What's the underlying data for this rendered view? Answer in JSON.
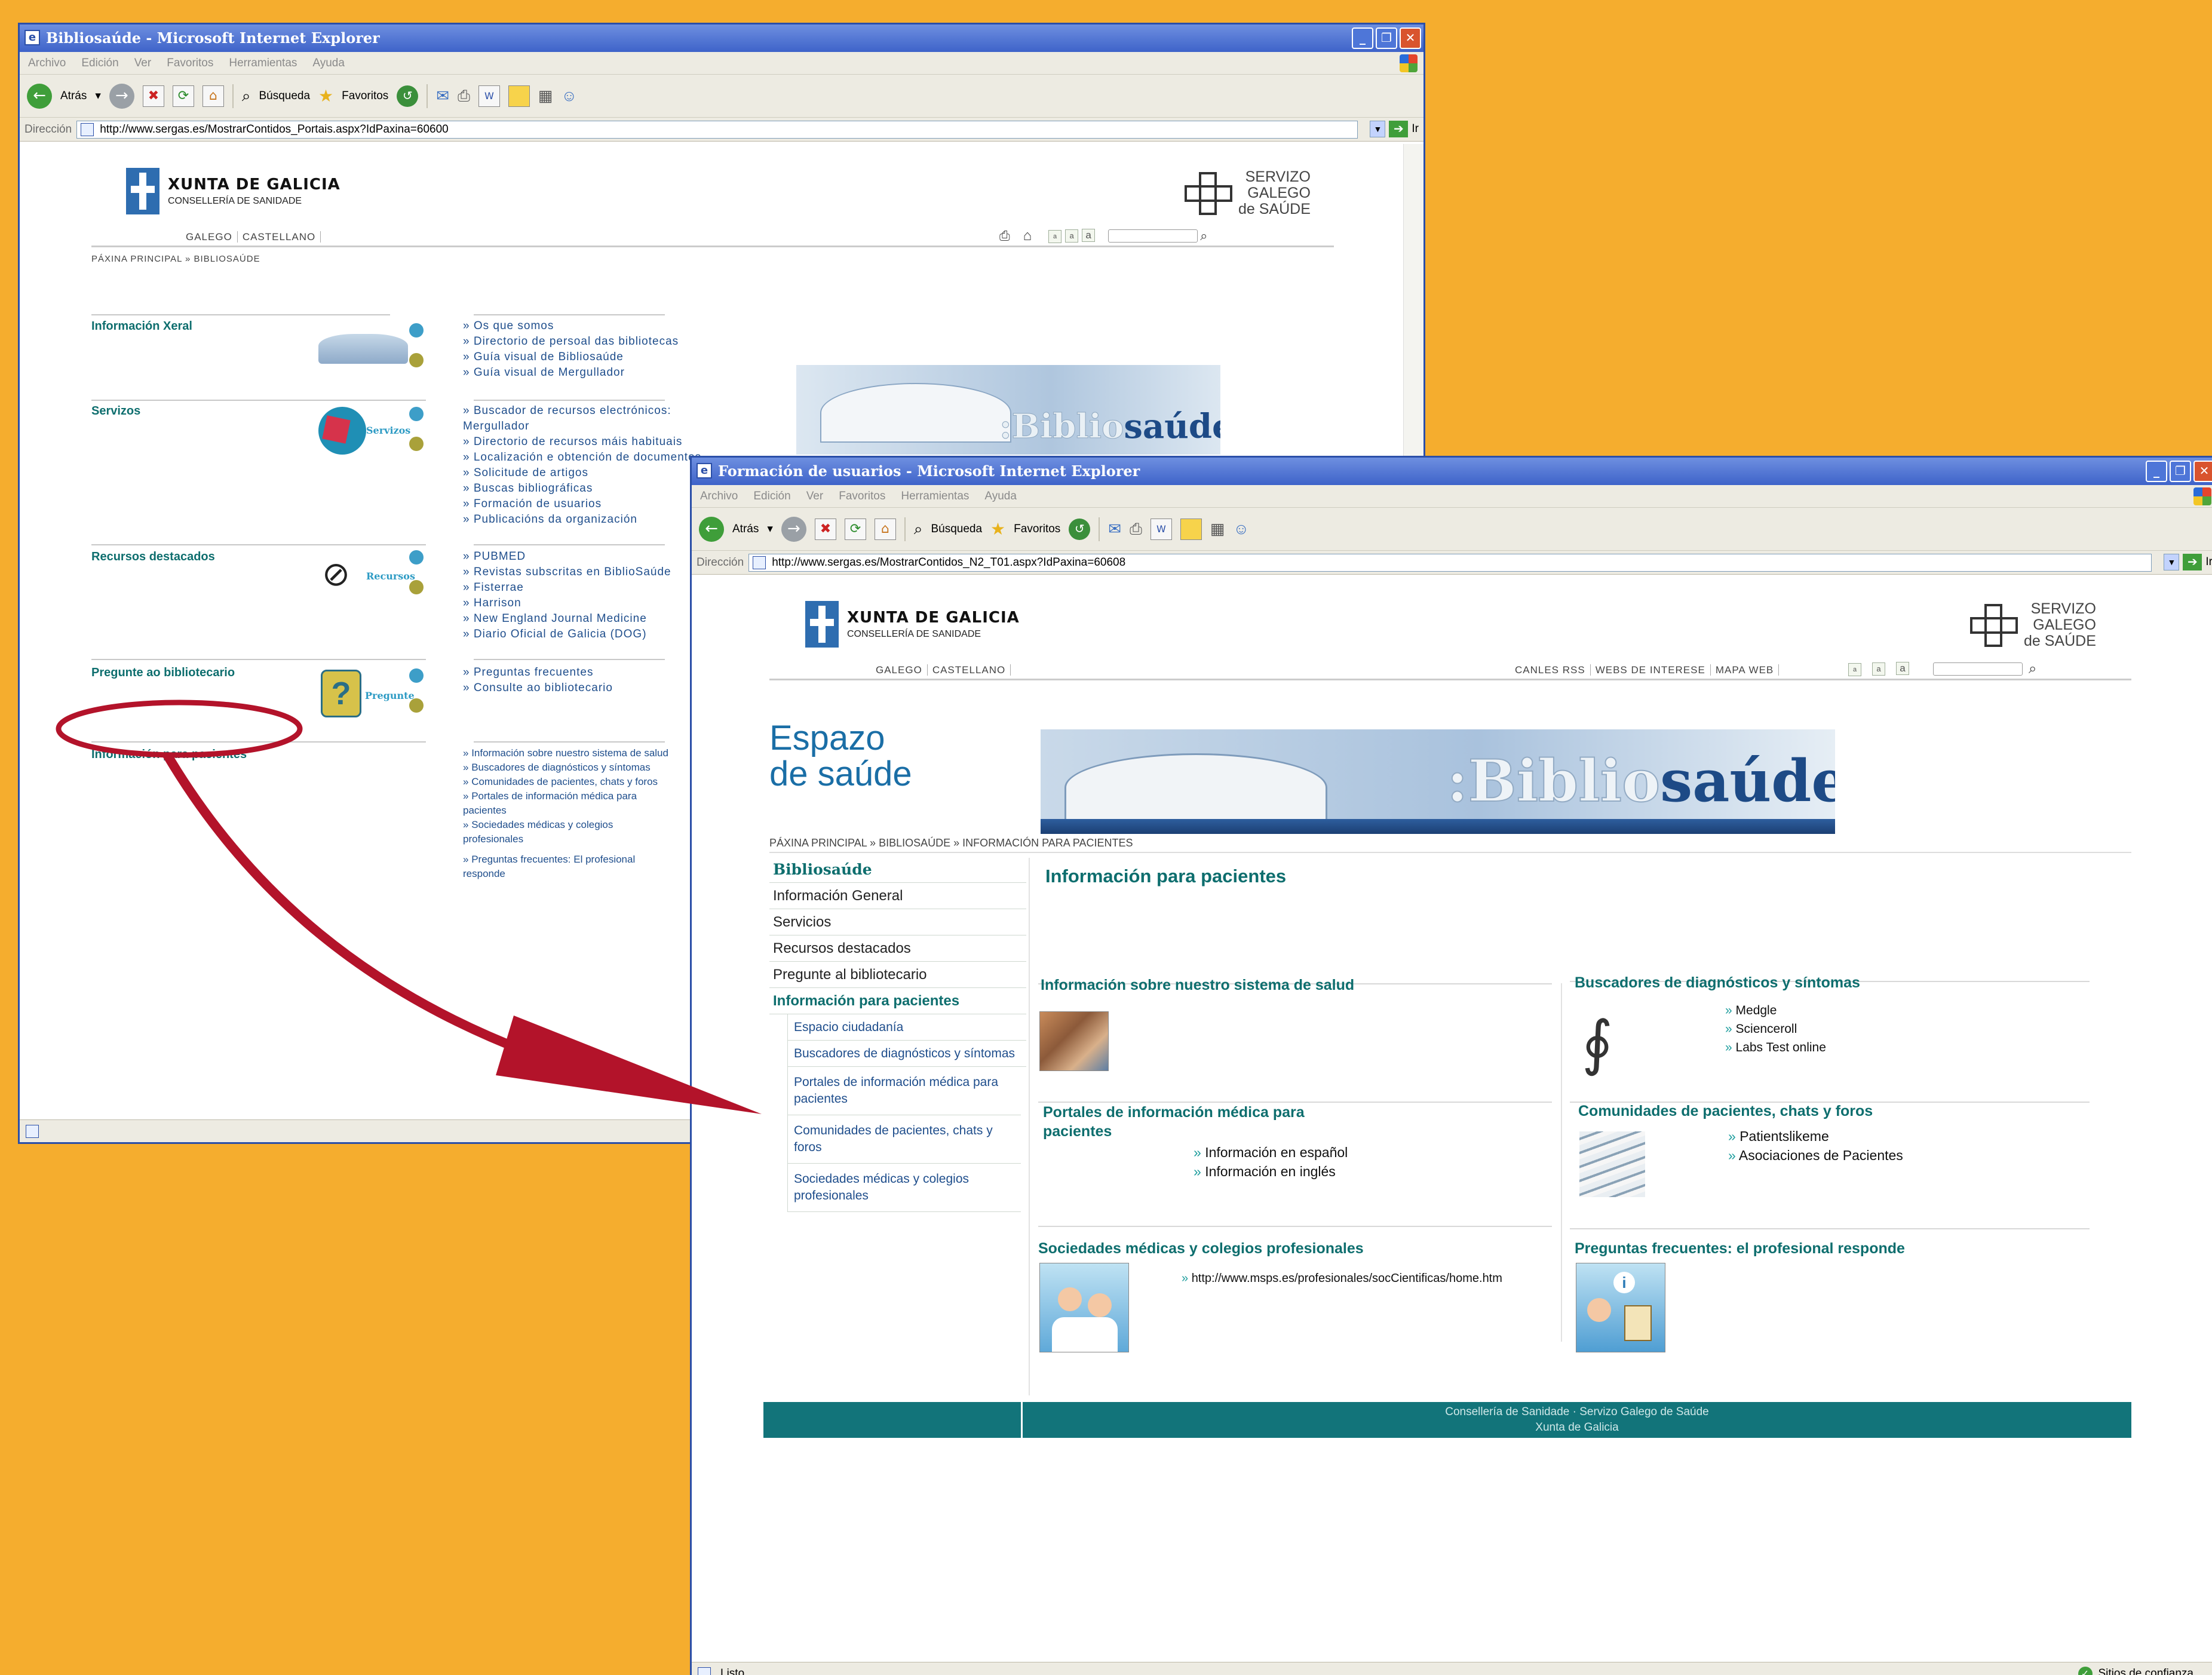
{
  "window1": {
    "title": "Bibliosaúde - Microsoft Internet Explorer",
    "menu": [
      "Archivo",
      "Edición",
      "Ver",
      "Favoritos",
      "Herramientas",
      "Ayuda"
    ],
    "toolbar": {
      "back": "Atrás",
      "search": "Búsqueda",
      "favorites": "Favoritos"
    },
    "address_label": "Dirección",
    "url": "http://www.sergas.es/MostrarContidos_Portais.aspx?IdPaxina=60600",
    "go": "Ir",
    "header": {
      "xunta_title": "XUNTA DE GALICIA",
      "xunta_sub": "CONSELLERÍA DE SANIDADE",
      "sergas_l1": "SERVIZO",
      "sergas_l2": "GALEGO",
      "sergas_l3": "de SAÚDE",
      "lang_gl": "GALEGO",
      "lang_es": "CASTELLANO",
      "font_small": "a",
      "font_medium": "a",
      "font_large": "a"
    },
    "breadcrumb": "PÁXINA PRINCIPAL » BIBLIOSAÚDE",
    "banner_text_light": ":Biblio",
    "banner_text_dark": "saúde",
    "sections": [
      {
        "title": "Información Xeral",
        "links": [
          "Os que somos",
          "Directorio de persoal das bibliotecas",
          "Guía visual de Bibliosaúde",
          "Guía visual de Mergullador"
        ]
      },
      {
        "title": "Servizos",
        "icon_label": "Servizos",
        "links": [
          "Buscador de recursos electrónicos: Mergullador",
          "Directorio de recursos máis habituais",
          "Localización e obtención de documentos",
          "Solicitude de artigos",
          "Buscas bibliográficas",
          "Formación de usuarios",
          "Publicacións da organización"
        ]
      },
      {
        "title": "Recursos destacados",
        "icon_label": "Recursos",
        "links": [
          "PUBMED",
          "Revistas subscritas en BiblioSaúde",
          "Fisterrae",
          "Harrison",
          "New England Journal Medicine",
          "Diario Oficial de Galicia (DOG)"
        ]
      },
      {
        "title": "Pregunte ao bibliotecario",
        "icon_label": "Pregunte",
        "links": [
          "Preguntas frecuentes",
          "Consulte ao bibliotecario"
        ]
      },
      {
        "title": "Información para pacientes",
        "links": [
          "Información sobre nuestro sistema de salud",
          "Buscadores de diagnósticos y síntomas",
          "Comunidades de pacientes, chats y foros",
          "Portales de información médica para pacientes",
          "Sociedades médicas y colegios profesionales",
          "Preguntas frecuentes: El profesional responde"
        ]
      }
    ]
  },
  "window2": {
    "title": "Formación de usuarios - Microsoft Internet Explorer",
    "menu": [
      "Archivo",
      "Edición",
      "Ver",
      "Favoritos",
      "Herramientas",
      "Ayuda"
    ],
    "toolbar": {
      "back": "Atrás",
      "search": "Búsqueda",
      "favorites": "Favoritos"
    },
    "address_label": "Dirección",
    "url": "http://www.sergas.es/MostrarContidos_N2_T01.aspx?IdPaxina=60608",
    "go": "Ir",
    "header": {
      "xunta_title": "XUNTA DE GALICIA",
      "xunta_sub": "CONSELLERÍA DE SANIDADE",
      "sergas_l1": "SERVIZO",
      "sergas_l2": "GALEGO",
      "sergas_l3": "de SAÚDE",
      "lang_gl": "GALEGO",
      "lang_es": "CASTELLANO",
      "nav": [
        "CANLES RSS",
        "WEBS DE INTERESE",
        "MAPA WEB"
      ],
      "font_small": "a",
      "font_medium": "a",
      "font_large": "a"
    },
    "espazo_l1": "Espazo",
    "espazo_l2": "de saúde",
    "banner_text_light": ":Biblio",
    "banner_text_dark": "saúde",
    "breadcrumb": "PÁXINA PRINCIPAL » BIBLIOSAÚDE » INFORMACIÓN PARA PACIENTES",
    "sidebar": {
      "heading": "Bibliosaúde",
      "items": [
        "Información General",
        "Servicios",
        "Recursos destacados",
        "Pregunte al bibliotecario"
      ],
      "active": "Información para pacientes",
      "subitems": [
        "Espacio ciudadanía",
        "Buscadores de diagnósticos y síntomas",
        "Portales de información médica para pacientes",
        "Comunidades de pacientes, chats y foros",
        "Sociedades médicas y colegios profesionales"
      ]
    },
    "page_title": "Información para pacientes",
    "blocks": {
      "sistema": {
        "title": "Información sobre nuestro sistema de salud"
      },
      "buscadores": {
        "title": "Buscadores de diagnósticos y síntomas",
        "links": [
          "Medgle",
          "Scienceroll",
          "Labs Test online"
        ]
      },
      "portales": {
        "title": "Portales de información médica para pacientes",
        "links": [
          "Información en español",
          "Información en inglés"
        ]
      },
      "comunidades": {
        "title": "Comunidades de pacientes, chats y foros",
        "links": [
          "Patientslikeme",
          "Asociaciones de Pacientes"
        ]
      },
      "sociedades": {
        "title": "Sociedades médicas y colegios profesionales",
        "links": [
          "http://www.msps.es/profesionales/socCientificas/home.htm"
        ]
      },
      "preguntas": {
        "title": "Preguntas frecuentes: el profesional responde"
      }
    },
    "footer_l1": "Consellería de Sanidade · Servizo Galego de Saúde",
    "footer_l2": "Xunta de Galicia",
    "status": "Listo",
    "zone": "Sitios de confianza"
  },
  "colors": {
    "background": "#F5AD2E",
    "teal": "#0E6E6E",
    "highlight": "#B3132A",
    "footer": "#12747A"
  }
}
